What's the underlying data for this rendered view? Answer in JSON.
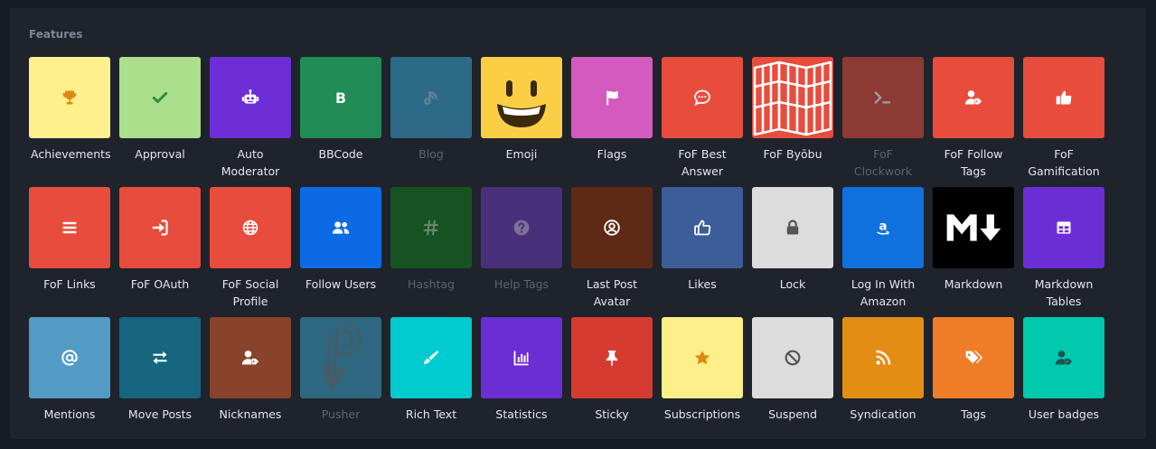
{
  "section": {
    "title": "Features"
  },
  "extensions": [
    {
      "label": "Achievements",
      "bg": "#fdf08d",
      "fg": "#dd8a14",
      "icon": "trophy-icon",
      "enabled": true
    },
    {
      "label": "Approval",
      "bg": "#acdf8c",
      "fg": "#2e8b3e",
      "icon": "check-icon",
      "enabled": true
    },
    {
      "label": "Auto Moderator",
      "bg": "#6d2ed8",
      "fg": "#ffffff",
      "icon": "robot-icon",
      "enabled": true
    },
    {
      "label": "BBCode",
      "bg": "#1f8d55",
      "fg": "#ffffff",
      "icon": "letter-b-icon",
      "enabled": true
    },
    {
      "label": "Blog",
      "bg": "#3aa5d5",
      "fg": "#9bd3ea",
      "icon": "blog-icon",
      "enabled": false
    },
    {
      "label": "Emoji",
      "bg": "#fbcf45",
      "fg": "#3c2a0c",
      "icon": "emoji-smiley-icon",
      "enabled": true
    },
    {
      "label": "Flags",
      "bg": "#d35bc0",
      "fg": "#ffffff",
      "icon": "flag-icon",
      "enabled": true
    },
    {
      "label": "FoF Best Answer",
      "bg": "#e74c3c",
      "fg": "#ffffff",
      "icon": "speech-bubble-icon",
      "enabled": true
    },
    {
      "label": "FoF Byōbu",
      "bg": "#e74c3c",
      "fg": "#ffffff",
      "icon": "folding-screen-icon",
      "enabled": true
    },
    {
      "label": "FoF Clockwork",
      "bg": "#e74c3c",
      "fg": "#ffffff",
      "icon": "terminal-icon",
      "enabled": false
    },
    {
      "label": "FoF Follow Tags",
      "bg": "#e74c3c",
      "fg": "#ffffff",
      "icon": "user-tag-icon",
      "enabled": true
    },
    {
      "label": "FoF Gamification",
      "bg": "#e74c3c",
      "fg": "#ffffff",
      "icon": "thumbs-up-icon",
      "enabled": true
    },
    {
      "label": "FoF Links",
      "bg": "#e74c3c",
      "fg": "#ffffff",
      "icon": "bars-icon",
      "enabled": true
    },
    {
      "label": "FoF OAuth",
      "bg": "#e74c3c",
      "fg": "#ffffff",
      "icon": "sign-in-icon",
      "enabled": true
    },
    {
      "label": "FoF Social Profile",
      "bg": "#e74c3c",
      "fg": "#ffffff",
      "icon": "globe-icon",
      "enabled": true
    },
    {
      "label": "Follow Users",
      "bg": "#0d6ae5",
      "fg": "#ffffff",
      "icon": "users-icon",
      "enabled": true
    },
    {
      "label": "Hashtag",
      "bg": "#107a1c",
      "fg": "#a7e0ac",
      "icon": "hashtag-icon",
      "enabled": false
    },
    {
      "label": "Help Tags",
      "bg": "#6d3bbd",
      "fg": "#c9b3ef",
      "icon": "question-circle-icon",
      "enabled": false
    },
    {
      "label": "Last Post Avatar",
      "bg": "#5e2a15",
      "fg": "#ffffff",
      "icon": "user-circle-icon",
      "enabled": true
    },
    {
      "label": "Likes",
      "bg": "#3c5d98",
      "fg": "#ffffff",
      "icon": "thumbs-up-outline-icon",
      "enabled": true
    },
    {
      "label": "Lock",
      "bg": "#dcdcdc",
      "fg": "#555555",
      "icon": "lock-icon",
      "enabled": true
    },
    {
      "label": "Log In With Amazon",
      "bg": "#0f71dd",
      "fg": "#ffffff",
      "icon": "amazon-icon",
      "enabled": true
    },
    {
      "label": "Markdown",
      "bg": "#000000",
      "fg": "#ffffff",
      "icon": "markdown-icon",
      "enabled": true
    },
    {
      "label": "Markdown Tables",
      "bg": "#6b2ed5",
      "fg": "#ffffff",
      "icon": "table-icon",
      "enabled": true
    },
    {
      "label": "Mentions",
      "bg": "#539bc4",
      "fg": "#ffffff",
      "icon": "at-sign-icon",
      "enabled": true
    },
    {
      "label": "Move Posts",
      "bg": "#15667e",
      "fg": "#ffffff",
      "icon": "exchange-arrows-icon",
      "enabled": true
    },
    {
      "label": "Nicknames",
      "bg": "#88432a",
      "fg": "#ffffff",
      "icon": "user-tag-icon",
      "enabled": true
    },
    {
      "label": "Pusher",
      "bg": "#3aa0c6",
      "fg": "#6d8a96",
      "icon": "pusher-logo-icon",
      "enabled": false
    },
    {
      "label": "Rich Text",
      "bg": "#00cbce",
      "fg": "#ffffff",
      "icon": "pen-icon",
      "enabled": true
    },
    {
      "label": "Statistics",
      "bg": "#6b2ed5",
      "fg": "#ffffff",
      "icon": "bar-chart-icon",
      "enabled": true
    },
    {
      "label": "Sticky",
      "bg": "#d63b31",
      "fg": "#ffffff",
      "icon": "thumbtack-icon",
      "enabled": true
    },
    {
      "label": "Subscriptions",
      "bg": "#fdef8a",
      "fg": "#de8a12",
      "icon": "star-icon",
      "enabled": true
    },
    {
      "label": "Suspend",
      "bg": "#dcdcdc",
      "fg": "#555555",
      "icon": "ban-icon",
      "enabled": true
    },
    {
      "label": "Syndication",
      "bg": "#e38d14",
      "fg": "#ffffff",
      "icon": "rss-icon",
      "enabled": true
    },
    {
      "label": "Tags",
      "bg": "#ef7d27",
      "fg": "#ffffff",
      "icon": "tags-icon",
      "enabled": true
    },
    {
      "label": "User badges",
      "bg": "#00c9ad",
      "fg": "#1c5450",
      "icon": "user-badge-icon",
      "enabled": true
    }
  ]
}
